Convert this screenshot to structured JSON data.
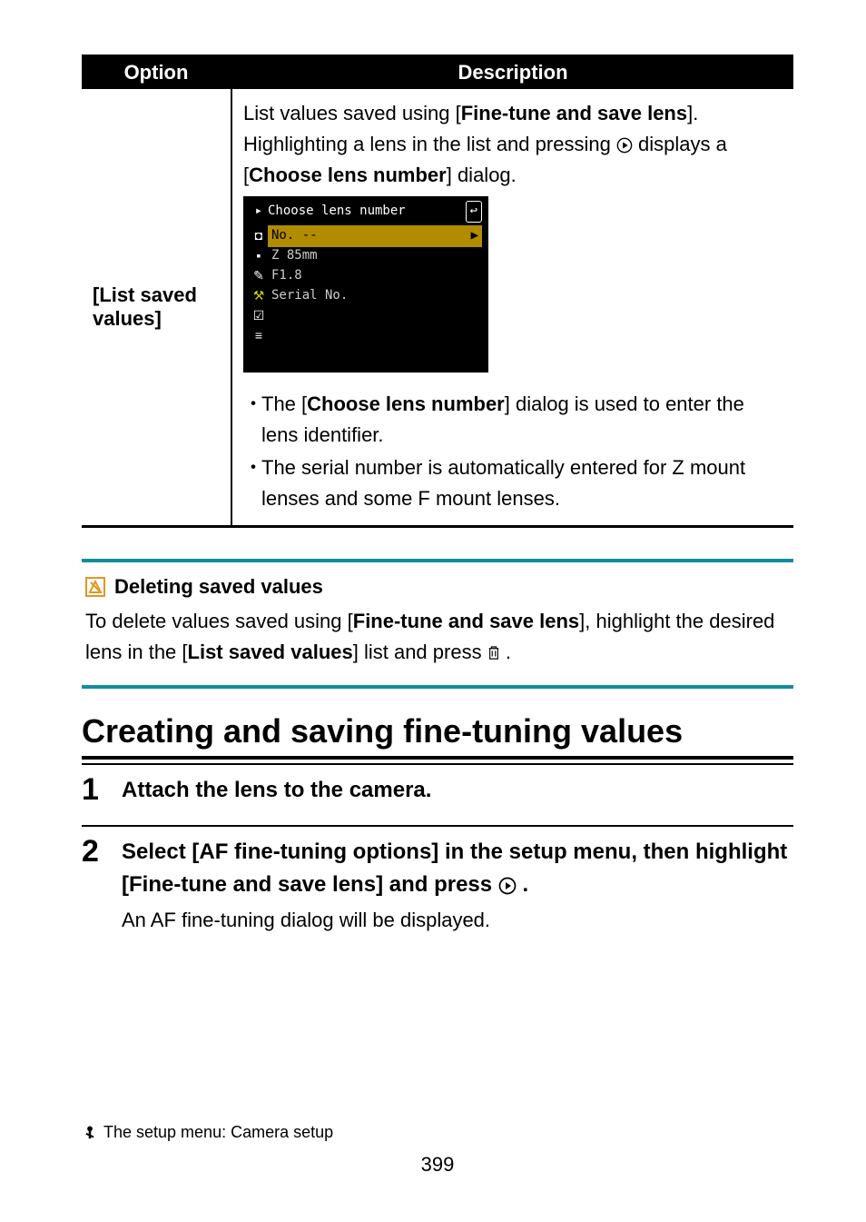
{
  "table": {
    "header_option": "Option",
    "header_desc": "Description",
    "row_option": "[List saved values]",
    "desc_intro_1": "List values saved using [",
    "desc_intro_bold1": "Fine-tune and save lens",
    "desc_intro_2": "]. Highlighting a lens in the list and pressing ",
    "desc_intro_icon": "▶",
    "desc_intro_3": " displays a [",
    "desc_intro_bold2": "Choose lens number",
    "desc_intro_4": "] dialog.",
    "bullet1_pre": "The [",
    "bullet1_bold": "Choose lens number",
    "bullet1_post": "] dialog is used to enter the lens identifier.",
    "bullet2": "The serial number is automatically entered for Z mount lenses and some F mount lenses."
  },
  "camera": {
    "title": "Choose lens number",
    "back": "↩",
    "line_no": "No. --",
    "line_lens": "Z 85mm",
    "line_f": "F1.8",
    "line_serial": "Serial No."
  },
  "note": {
    "title": "Deleting saved values",
    "body_1": "To delete values saved using [",
    "body_bold1": "Fine-tune and save lens",
    "body_2": "], highlight the desired lens in the [",
    "body_bold2": "List saved values",
    "body_3": "] list and press ",
    "body_icon": "🗑",
    "body_4": "."
  },
  "section_heading": "Creating and saving fine-tuning values",
  "steps": {
    "s1_num": "1",
    "s1_title": "Attach the lens to the camera.",
    "s2_num": "2",
    "s2_title_a": "Select [AF fine-tuning options] in the setup menu, then highlight [Fine-tune and save lens] and press ",
    "s2_icon": "▶",
    "s2_title_b": ".",
    "s2_sub": "An AF fine-tuning dialog will be displayed."
  },
  "footer": {
    "icon": "🔧",
    "text": "The setup menu: Camera setup",
    "page": "399"
  }
}
